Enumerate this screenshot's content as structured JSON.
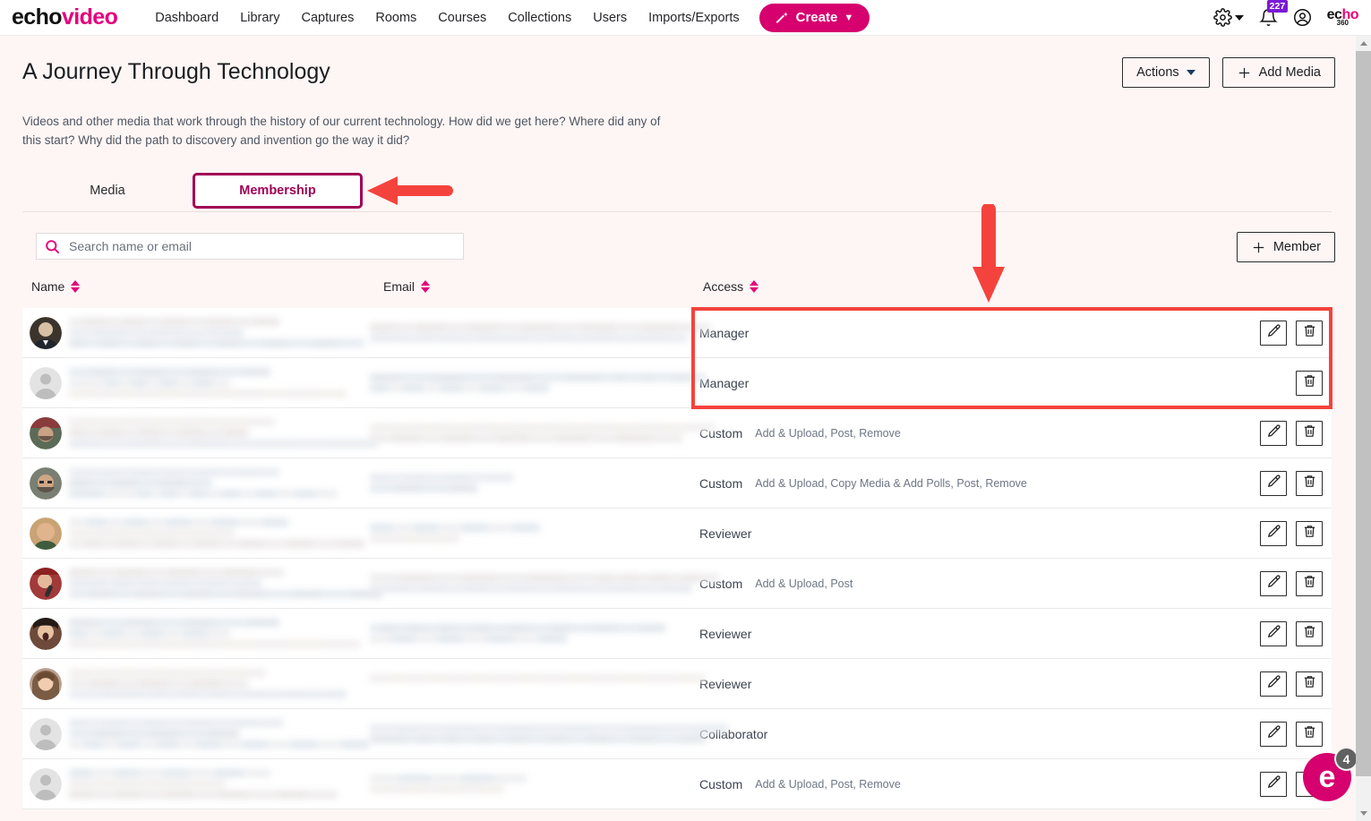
{
  "topnav": {
    "brand_first": "echo",
    "brand_second": "video",
    "links": [
      {
        "label": "Dashboard"
      },
      {
        "label": "Library"
      },
      {
        "label": "Captures"
      },
      {
        "label": "Rooms"
      },
      {
        "label": "Courses"
      },
      {
        "label": "Collections"
      },
      {
        "label": "Users"
      },
      {
        "label": "Imports/Exports"
      }
    ],
    "create_label": "Create",
    "create_caret": "⌄",
    "notification_count": "227",
    "logo_echo_1": "ec",
    "logo_echo_2": "ho",
    "logo_number": "360",
    "colors": {
      "brand_pink": "#e5007d",
      "create_bg": "#d6006e",
      "badge_purple": "#7b19d6"
    }
  },
  "header": {
    "title": "A Journey Through Technology",
    "description": "Videos and other media that work through the history of our current technology. How did we get here? Where did any of this start? Why did the path to discovery and invention go the way it did?",
    "actions_label": "Actions",
    "add_media_label": "Add Media",
    "add_media_plus": "+"
  },
  "tabs": [
    {
      "label": "Media",
      "active": false
    },
    {
      "label": "Membership",
      "active": true
    }
  ],
  "toolbar": {
    "search_placeholder": "Search name or email",
    "search_value": "",
    "member_label": "Member",
    "member_plus": "+"
  },
  "table": {
    "columns": [
      {
        "label": "Name",
        "sortable": true
      },
      {
        "label": "Email",
        "sortable": true
      },
      {
        "label": "Access",
        "sortable": true
      }
    ],
    "rows": [
      {
        "avatar": "photo-man-suit",
        "access": "Manager",
        "perms": "",
        "name_redacted": true,
        "email_redacted": true,
        "has_edit": true,
        "has_delete": true
      },
      {
        "avatar": "default-person",
        "access": "Manager",
        "perms": "",
        "name_redacted": true,
        "email_redacted": true,
        "has_edit": false,
        "has_delete": true
      },
      {
        "avatar": "photo-beard-cap",
        "access": "Custom",
        "perms": "Add & Upload, Post, Remove",
        "name_redacted": true,
        "email_redacted": true,
        "has_edit": true,
        "has_delete": true
      },
      {
        "avatar": "photo-glasses",
        "access": "Custom",
        "perms": "Add & Upload, Copy Media & Add Polls, Post, Remove",
        "name_redacted": true,
        "email_redacted": true,
        "has_edit": true,
        "has_delete": true
      },
      {
        "avatar": "photo-child",
        "access": "Reviewer",
        "perms": "",
        "name_redacted": true,
        "email_redacted": true,
        "has_edit": true,
        "has_delete": true
      },
      {
        "avatar": "photo-singer",
        "access": "Custom",
        "perms": "Add & Upload, Post",
        "name_redacted": true,
        "email_redacted": true,
        "has_edit": true,
        "has_delete": true
      },
      {
        "avatar": "photo-shout",
        "access": "Reviewer",
        "perms": "",
        "name_redacted": true,
        "email_redacted": true,
        "has_edit": true,
        "has_delete": true
      },
      {
        "avatar": "photo-woman",
        "access": "Reviewer",
        "perms": "",
        "name_redacted": true,
        "email_redacted": true,
        "has_edit": true,
        "has_delete": true
      },
      {
        "avatar": "default-person",
        "access": "Collaborator",
        "perms": "",
        "name_redacted": true,
        "email_redacted": true,
        "has_edit": true,
        "has_delete": true
      },
      {
        "avatar": "default-person",
        "access": "Custom",
        "perms": "Add & Upload, Post, Remove",
        "name_redacted": true,
        "email_redacted": true,
        "has_edit": true,
        "has_delete": true
      }
    ]
  },
  "annotations": {
    "arrow_color": "#f4433c",
    "highlight_rect_color": "#f4433c",
    "tab_highlight_color": "#a00055"
  },
  "chat": {
    "label": "e",
    "unread": "4"
  }
}
